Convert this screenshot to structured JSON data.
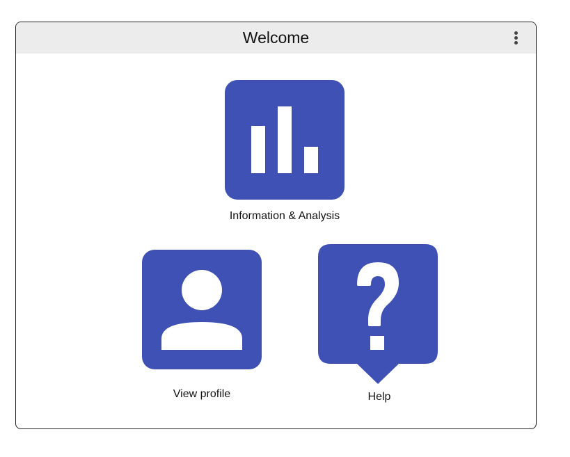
{
  "window": {
    "title": "Welcome",
    "menu_icon": "kebab-menu-icon"
  },
  "tiles": [
    {
      "label": "Information & Analysis",
      "icon": "bar-chart-icon"
    },
    {
      "label": "View profile",
      "icon": "person-icon"
    },
    {
      "label": "Help",
      "icon": "question-bubble-icon"
    }
  ],
  "colors": {
    "accent": "#3f51b5",
    "titlebar": "#ececec",
    "icon_glyph": "#ffffff"
  }
}
